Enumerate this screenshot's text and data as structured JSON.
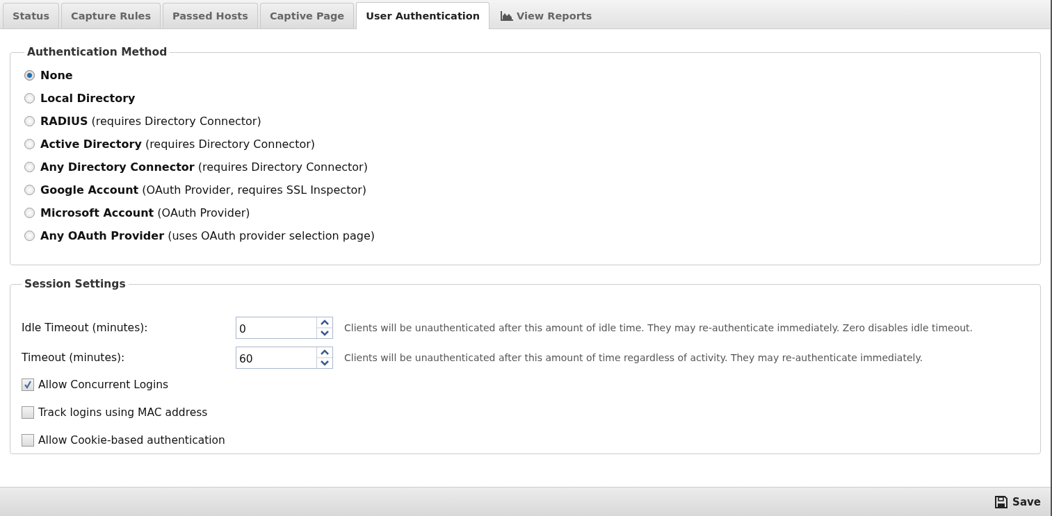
{
  "tabs": [
    {
      "label": "Status",
      "selected": false,
      "kind": "plain"
    },
    {
      "label": "Capture Rules",
      "selected": false,
      "kind": "plain"
    },
    {
      "label": "Passed Hosts",
      "selected": false,
      "kind": "plain"
    },
    {
      "label": "Captive Page",
      "selected": false,
      "kind": "plain"
    },
    {
      "label": "User Authentication",
      "selected": true,
      "kind": "plain"
    },
    {
      "label": "View Reports",
      "selected": false,
      "kind": "reports"
    }
  ],
  "authentication_method": {
    "legend": "Authentication Method",
    "options": [
      {
        "name": "None",
        "selected": true
      },
      {
        "name": "Local Directory",
        "selected": false
      },
      {
        "name": "RADIUS",
        "note": "(requires Directory Connector)",
        "selected": false
      },
      {
        "name": "Active Directory",
        "note": "(requires Directory Connector)",
        "selected": false
      },
      {
        "name": "Any Directory Connector",
        "note": "(requires Directory Connector)",
        "selected": false
      },
      {
        "name": "Google Account",
        "note": "(OAuth Provider, requires SSL Inspector)",
        "selected": false
      },
      {
        "name": "Microsoft Account",
        "note": "(OAuth Provider)",
        "selected": false
      },
      {
        "name": "Any OAuth Provider",
        "note": "(uses OAuth provider selection page)",
        "selected": false
      }
    ]
  },
  "session_settings": {
    "legend": "Session Settings",
    "fields": [
      {
        "label": "Idle Timeout (minutes):",
        "value": "0",
        "hint": "Clients will be unauthenticated after this amount of idle time. They may re-authenticate immediately. Zero disables idle timeout."
      },
      {
        "label": "Timeout (minutes):",
        "value": "60",
        "hint": "Clients will be unauthenticated after this amount of time regardless of activity. They may re-authenticate immediately."
      }
    ],
    "checkboxes": [
      {
        "label": "Allow Concurrent Logins",
        "checked": true
      },
      {
        "label": "Track logins using MAC address",
        "checked": false
      },
      {
        "label": "Allow Cookie-based authentication",
        "checked": false
      }
    ]
  },
  "footer": {
    "save_label": "Save"
  }
}
